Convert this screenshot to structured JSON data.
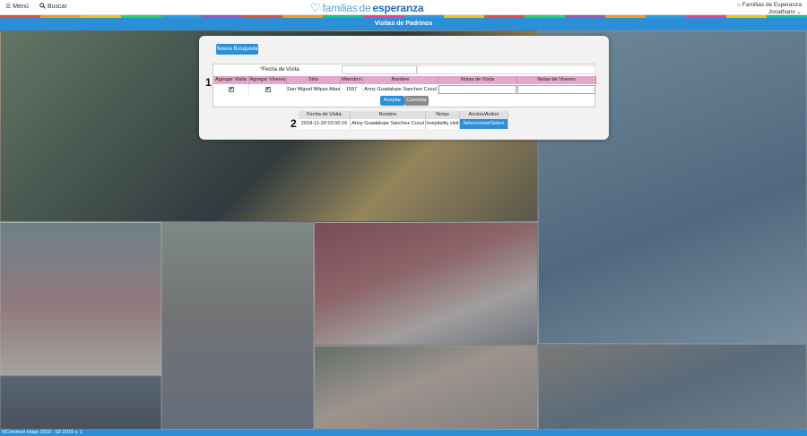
{
  "topbar": {
    "menu_label": "Menú",
    "search_label": "Buscar",
    "logo_light": "familias",
    "logo_mid": "de",
    "logo_bold": "esperanza",
    "org_name": "Familias de Esperanza",
    "user_name": "Jonathanv"
  },
  "stripe_colors": [
    "#e94e3c",
    "#f39c12",
    "#f1c40f",
    "#2ecc71",
    "#3498db",
    "#9b59b6",
    "#e94e3c",
    "#f39c12",
    "#1abc9c",
    "#e84393",
    "#3498db",
    "#f1c40f",
    "#e94e3c",
    "#2ecc71",
    "#9b59b6",
    "#f39c12",
    "#3498db",
    "#e84393",
    "#f1c40f",
    "#1abc9c"
  ],
  "page_title": "Visitas de Padrinos",
  "modal": {
    "new_search": "Nueva Búsqueda",
    "marker1": "1",
    "marker2": "2",
    "date_label": "Fecha de Visita",
    "grid_headers": [
      "Agregar Visita",
      "Agregar Viveres",
      "Sitio",
      "Miembro",
      "Nombre",
      "Notas de Visita",
      "Notas de Viveres"
    ],
    "grid_row": {
      "visit_check": "✔",
      "supplies_check": "✔",
      "site": "San Miguel Milpas Altas",
      "member": "1597",
      "name": "Anny Guadalupe Sanchez Cucul"
    },
    "accept_label": "Aceptar",
    "cancel_label": "Cancelar",
    "results_headers": [
      "Fecha de Visita",
      "Nombre",
      "Notas",
      "Accion/Action"
    ],
    "results_row": {
      "date": "2018-11-20 02:00:16",
      "name": "Anny Guadalupe Sanchez Cucul",
      "notes": "hospitality visit",
      "action": "Seleccionar/Select"
    }
  },
  "footer_text": "©Common Hope 2019 - 02-2019 v. 1"
}
